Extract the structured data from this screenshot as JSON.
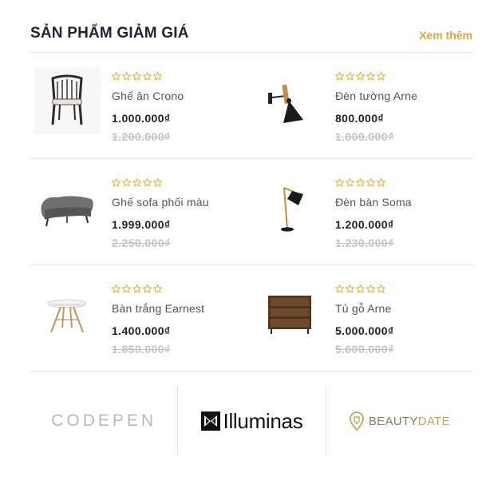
{
  "section": {
    "title": "SẢN PHẨM GIẢM GIÁ",
    "see_more": "Xem thêm"
  },
  "products": [
    {
      "name": "Ghế ăn Crono",
      "price": "1.000.000₫",
      "old_price": "1.200.000₫",
      "rating": 0,
      "image_icon": "dining-chair-icon"
    },
    {
      "name": "Đèn tường Arne",
      "price": "800.000₫",
      "old_price": "1.000.000₫",
      "rating": 0,
      "image_icon": "wall-lamp-icon"
    },
    {
      "name": "Ghế sofa phối màu",
      "price": "1.999.000₫",
      "old_price": "2.250.000₫",
      "rating": 0,
      "image_icon": "sofa-icon"
    },
    {
      "name": "Đèn bàn Soma",
      "price": "1.200.000₫",
      "old_price": "1.230.000₫",
      "rating": 0,
      "image_icon": "table-lamp-icon"
    },
    {
      "name": "Bàn trắng Earnest",
      "price": "1.400.000₫",
      "old_price": "1.850.000₫",
      "rating": 0,
      "image_icon": "round-table-icon"
    },
    {
      "name": "Tủ gỗ Arne",
      "price": "5.000.000₫",
      "old_price": "5.600.000₫",
      "rating": 0,
      "image_icon": "wood-dresser-icon"
    }
  ],
  "brands": {
    "codepen": "CODEPEN",
    "illuminas": "Illuminas",
    "beautydate_a": "BEAUTY",
    "beautydate_b": "DATE"
  },
  "colors": {
    "accent": "#d4a646",
    "title": "#1f2333",
    "old_price": "#c3c3c3"
  }
}
